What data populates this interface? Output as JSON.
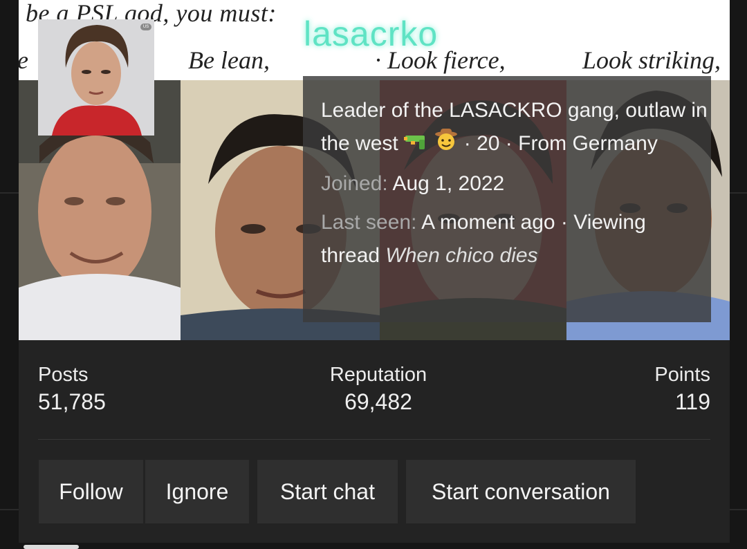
{
  "profile": {
    "username": "lasacrko",
    "bio": "Leader of the LASACKRO gang, outlaw in the west",
    "age_location": "· 20 · From Germany",
    "joined_label": "Joined:",
    "joined_value": "Aug 1, 2022",
    "last_seen_label": "Last seen:",
    "last_seen_value": "A moment ago · Viewing thread",
    "thread_title": "When chico dies",
    "avatar_badge": "US"
  },
  "banner": {
    "caption_top": "be a PSL god, you must:",
    "caption_e": "e",
    "caption_1": "Be lean,",
    "caption_2": "· Look fierce,",
    "caption_3": "Look striking,"
  },
  "stats": [
    {
      "label": "Posts",
      "value": "51,785"
    },
    {
      "label": "Reputation",
      "value": "69,482"
    },
    {
      "label": "Points",
      "value": "119"
    }
  ],
  "actions": {
    "follow": "Follow",
    "ignore": "Ignore",
    "start_chat": "Start chat",
    "start_conversation": "Start conversation"
  },
  "icons": [
    "water-gun-icon",
    "cowboy-face-icon"
  ],
  "colors": {
    "username": "#5fe3c4",
    "card_bg": "#232323",
    "button_bg": "#2f2f2f"
  }
}
